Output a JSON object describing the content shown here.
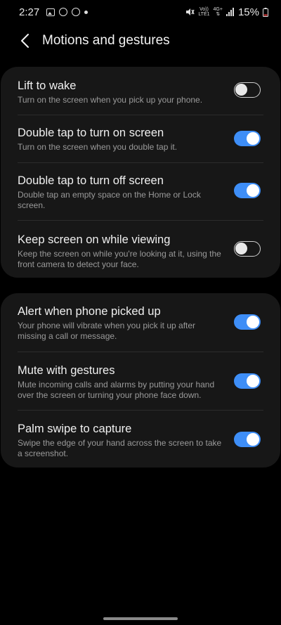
{
  "status_bar": {
    "time": "2:27",
    "battery_percent": "15%",
    "network_volte": "Vo))",
    "network_lte": "LTE1",
    "network_type": "4G+",
    "icons": [
      "gallery-icon",
      "status-app-icon",
      "whatsapp-icon",
      "dot-icon",
      "mute-icon",
      "signal-icon",
      "battery-icon"
    ]
  },
  "header": {
    "title": "Motions and gestures",
    "back_icon": "chevron-left-icon"
  },
  "colors": {
    "background": "#000000",
    "card": "#171717",
    "toggle_on": "#3e8ef7",
    "toggle_off_border": "#cfcfcf",
    "description": "#9a9a9a"
  },
  "settings_group_1": [
    {
      "title": "Lift to wake",
      "description": "Turn on the screen when you pick up your phone.",
      "enabled": false
    },
    {
      "title": "Double tap to turn on screen",
      "description": "Turn on the screen when you double tap it.",
      "enabled": true
    },
    {
      "title": "Double tap to turn off screen",
      "description": "Double tap an empty space on the Home or Lock screen.",
      "enabled": true
    },
    {
      "title": "Keep screen on while viewing",
      "description": "Keep the screen on while you're looking at it, using the front camera to detect your face.",
      "enabled": false
    }
  ],
  "settings_group_2": [
    {
      "title": "Alert when phone picked up",
      "description": "Your phone will vibrate when you pick it up after missing a call or message.",
      "enabled": true
    },
    {
      "title": "Mute with gestures",
      "description": "Mute incoming calls and alarms by putting your hand over the screen or turning your phone face down.",
      "enabled": true
    },
    {
      "title": "Palm swipe to capture",
      "description": "Swipe the edge of your hand across the screen to take a screenshot.",
      "enabled": true
    }
  ]
}
